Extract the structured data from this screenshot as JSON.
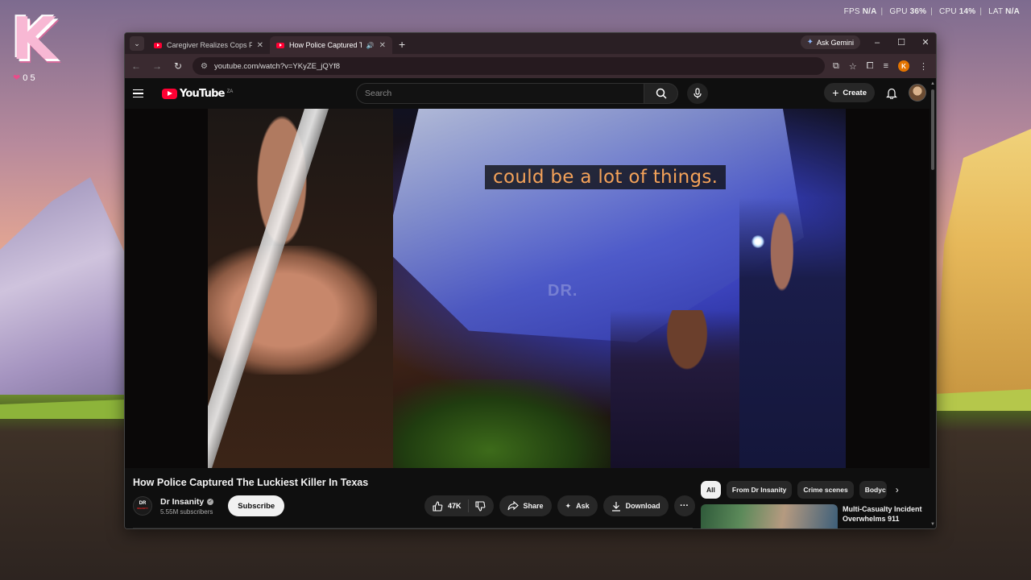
{
  "desktop": {
    "logo_letter": "K",
    "logo_meta": "0 5",
    "stats": {
      "fps_label": "FPS",
      "fps_value": "N/A",
      "gpu_label": "GPU",
      "gpu_value": "36%",
      "cpu_label": "CPU",
      "cpu_value": "14%",
      "lat_label": "LAT",
      "lat_value": "N/A"
    }
  },
  "browser": {
    "tabs": [
      {
        "title": "Caregiver Realizes Cops Found",
        "active": false
      },
      {
        "title": "How Police Captured The L",
        "active": true
      }
    ],
    "gemini_label": "Ask Gemini",
    "url": "youtube.com/watch?v=YKyZE_jQYf8",
    "profile_initial": "K"
  },
  "youtube": {
    "logo_text": "YouTube",
    "region": "ZA",
    "search_placeholder": "Search",
    "create_label": "Create",
    "subtitle": "could be a lot of things.",
    "watermark": "DR.",
    "video_title": "How Police Captured The Luckiest Killer In Texas",
    "channel": {
      "name": "Dr Insanity",
      "subscribers": "5.55M subscribers",
      "avatar_text_top": "DR",
      "avatar_text_bottom": "INSANITY"
    },
    "subscribe_label": "Subscribe",
    "likes": "47K",
    "share_label": "Share",
    "ask_label": "Ask",
    "download_label": "Download",
    "chips": [
      "All",
      "From Dr Insanity",
      "Crime scenes",
      "Bodyc"
    ],
    "related": {
      "title": "Multi-Casualty Incident Overwhelms 911"
    }
  }
}
